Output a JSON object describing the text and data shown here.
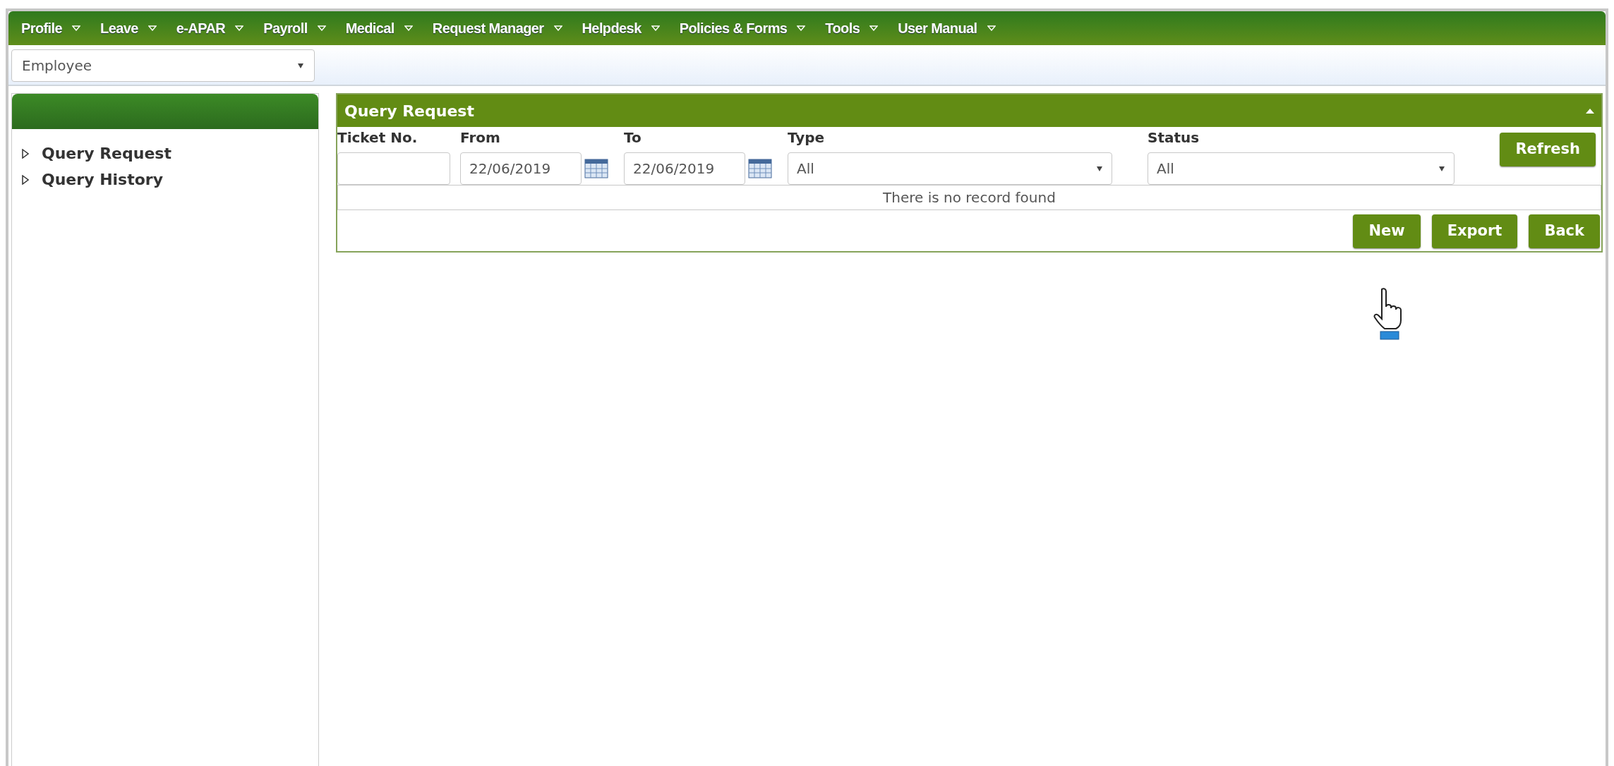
{
  "menu": [
    {
      "label": "Profile"
    },
    {
      "label": "Leave"
    },
    {
      "label": "e-APAR"
    },
    {
      "label": "Payroll"
    },
    {
      "label": "Medical"
    },
    {
      "label": "Request Manager"
    },
    {
      "label": "Helpdesk"
    },
    {
      "label": "Policies & Forms"
    },
    {
      "label": "Tools"
    },
    {
      "label": "User Manual"
    }
  ],
  "role_select": {
    "value": "Employee"
  },
  "sidebar": {
    "items": [
      {
        "label": "Query Request"
      },
      {
        "label": "Query History"
      }
    ]
  },
  "panel": {
    "title": "Query Request",
    "filters": [
      {
        "kind": "text",
        "label": "Ticket No."
      },
      {
        "kind": "date",
        "label": "From",
        "value": "22/06/2019"
      },
      {
        "kind": "date",
        "label": "To",
        "value": "22/06/2019"
      },
      {
        "kind": "select",
        "label": "Type",
        "value": "All"
      },
      {
        "kind": "select",
        "label": "Status",
        "value": "All"
      }
    ],
    "refresh_button": "Refresh",
    "message": "There is no record found",
    "buttons": [
      "New",
      "Export",
      "Back"
    ]
  }
}
